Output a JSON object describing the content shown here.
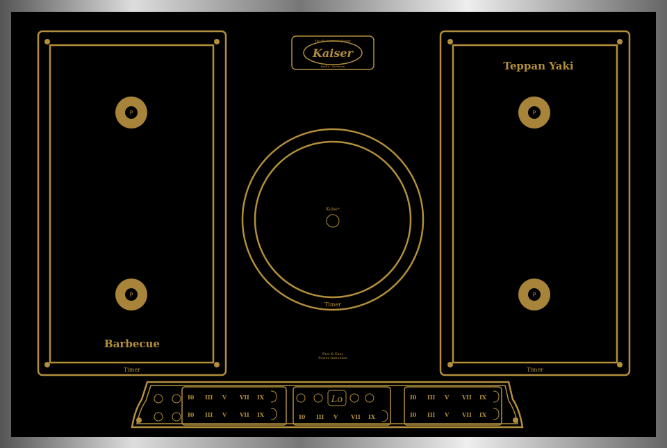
{
  "brand": {
    "logo": "Kaiser",
    "logo_top": "Für alle Markenliebhaber",
    "logo_bottom": "Berlin · Germany"
  },
  "zones": {
    "left": {
      "label": "Barbecue",
      "timer": "Timer"
    },
    "center": {
      "timer": "Timer"
    },
    "right": {
      "label": "Teppan Yaki",
      "timer": "Timer"
    }
  },
  "pot_symbol": "P",
  "center_tagline": [
    "Frei & Easy",
    "Power Induction"
  ],
  "controls": {
    "display": "Lo",
    "slider_levels": [
      "I0",
      "III",
      "V",
      "VII",
      "IX"
    ],
    "left_buttons": [
      "power-icon",
      "lock-icon",
      "keep-warm-icon",
      "bridge-icon"
    ]
  },
  "colors": {
    "gold": "#b38f3c",
    "glass": "#000000"
  }
}
